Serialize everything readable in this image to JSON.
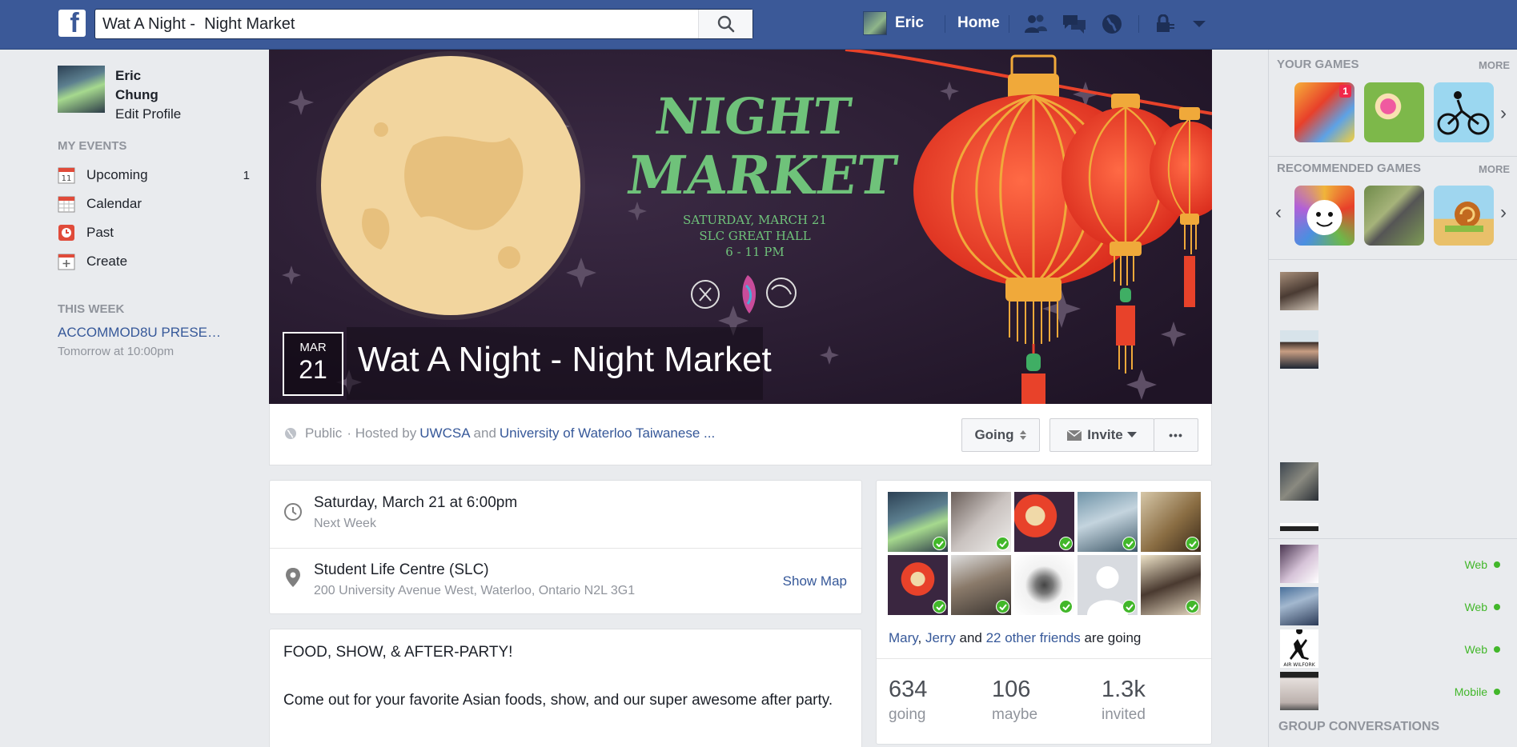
{
  "topbar": {
    "search_value": "Wat A Night -  Night Market",
    "user_name": "Eric",
    "home_label": "Home"
  },
  "left": {
    "profile_name": "Eric Chung",
    "edit_profile": "Edit Profile",
    "my_events_heading": "MY EVENTS",
    "events": [
      {
        "label": "Upcoming",
        "count": "1"
      },
      {
        "label": "Calendar",
        "count": ""
      },
      {
        "label": "Past",
        "count": ""
      },
      {
        "label": "Create",
        "count": ""
      }
    ],
    "this_week_heading": "THIS WEEK",
    "this_week_event": "ACCOMMOD8U PRESE…",
    "this_week_time": "Tomorrow at 10:00pm"
  },
  "cover": {
    "poster_title_line1": "NIGHT",
    "poster_title_line2": "MARKET",
    "poster_date": "SATURDAY, MARCH 21",
    "poster_venue": "SLC GREAT HALL",
    "poster_time": "6 - 11 PM"
  },
  "event": {
    "month": "MAR",
    "day": "21",
    "title": "Wat A Night - Night Market",
    "privacy": "Public",
    "hosted_by": "· Hosted by",
    "host1": "UWCSA",
    "and": "and",
    "host2": "University of Waterloo Taiwanese ...",
    "going_btn": "Going",
    "invite_btn": "Invite",
    "more_btn": "•••"
  },
  "details": {
    "date_main": "Saturday, March 21 at 6:00pm",
    "date_sub": "Next Week",
    "location_main": "Student Life Centre (SLC)",
    "location_sub": "200 University Avenue West, Waterloo, Ontario N2L 3G1",
    "show_map": "Show Map"
  },
  "description": {
    "headline": "FOOD, SHOW, & AFTER-PARTY!",
    "body": "Come out for your favorite Asian foods, show, and our super awesome after party."
  },
  "friends": {
    "friend1": "Mary",
    "friend2": "Jerry",
    "and": "and",
    "others": "22 other friends",
    "suffix": "are going",
    "stats": [
      {
        "num": "634",
        "label": "going"
      },
      {
        "num": "106",
        "label": "maybe"
      },
      {
        "num": "1.3k",
        "label": "invited"
      }
    ]
  },
  "right": {
    "your_games": "YOUR GAMES",
    "more1": "MORE",
    "game_badge": "1",
    "recommended_games": "RECOMMENDED GAMES",
    "more2": "MORE",
    "presence": [
      "Web",
      "Web",
      "Web",
      "Mobile"
    ],
    "group_conversations": "GROUP CONVERSATIONS",
    "contact_caption": "AIR WILFORK"
  },
  "colors": {
    "brand": "#3b5998",
    "link": "#365899",
    "online": "#42b72a",
    "poster_green": "#6fc27a",
    "lantern_red": "#e8422a"
  }
}
